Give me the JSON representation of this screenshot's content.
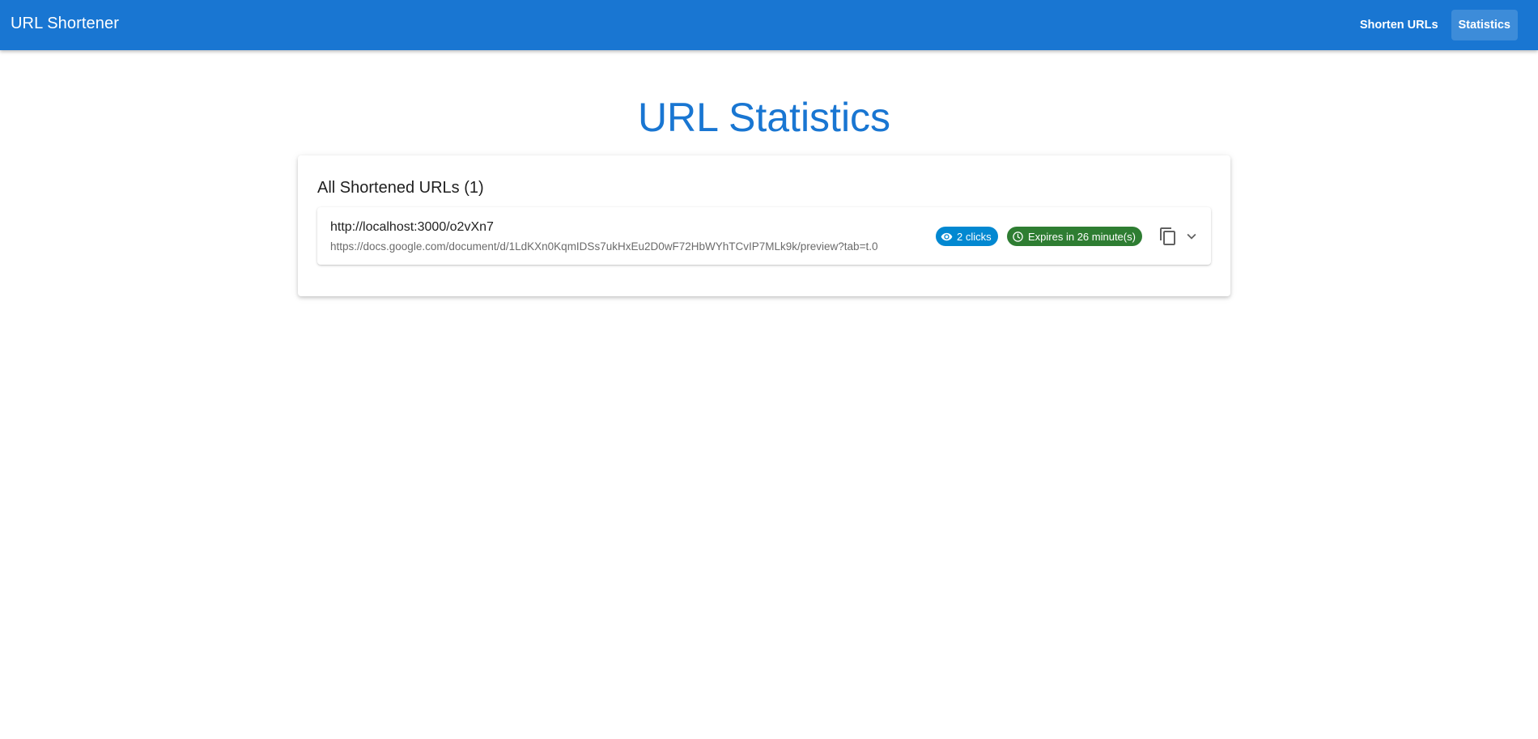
{
  "app": {
    "title": "URL Shortener",
    "nav": [
      {
        "label": "Shorten URLs",
        "active": false
      },
      {
        "label": "Statistics",
        "active": true
      }
    ],
    "brand_color": "#1976d2"
  },
  "page": {
    "title": "URL Statistics"
  },
  "card": {
    "heading": "All Shortened URLs (1)",
    "rows": [
      {
        "short_url": "http://localhost:3000/o2vXn7",
        "long_url": "https://docs.google.com/document/d/1LdKXn0KqmIDSs7ukHxEu2D0wF72HbWYhTCvIP7MLk9k/preview?tab=t.0",
        "clicks_label": "2 clicks",
        "clicks_icon": "eye-icon",
        "clicks_color": "#0288d1",
        "expiry_label": "Expires in 26 minute(s)",
        "expiry_icon": "clock-icon",
        "expiry_color": "#2e7d32",
        "copy_icon": "copy-icon",
        "expand_icon": "chevron-down-icon"
      }
    ]
  }
}
